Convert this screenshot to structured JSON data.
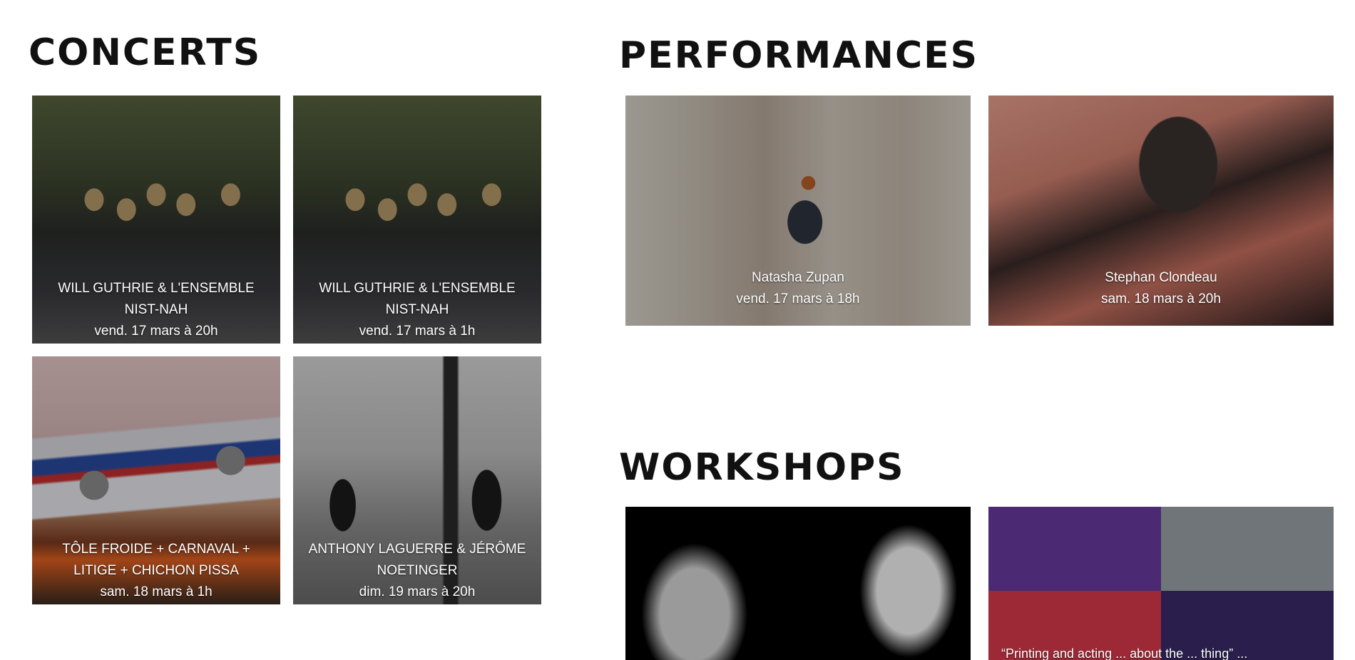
{
  "sections": {
    "concerts": {
      "title": "CONCERTS",
      "cards": [
        {
          "title": "WILL GUTHRIE & l'ENSEMBLE NIST-NAH",
          "date": "vend. 17 mars à 20h"
        },
        {
          "title": "WILL GUTHRIE & l'ENSEMBLE NIST-NAH",
          "date": "vend. 17 mars à 1h"
        },
        {
          "title": "TÔLE FROIDE + CARNAVAL + LITIGE + CHICHON PISSA",
          "date": "sam. 18 mars à 1h"
        },
        {
          "title": "ANTHONY LAGUERRE & JÉRÔME NOETINGER",
          "date": "dim. 19 mars à 20h"
        }
      ]
    },
    "performances": {
      "title": "PERFORMANCES",
      "cards": [
        {
          "title": "Natasha Zupan",
          "date": "vend. 17 mars à 18h"
        },
        {
          "title": "Stephan Clondeau",
          "date": "sam. 18 mars à 20h"
        }
      ]
    },
    "workshops": {
      "title": "WORKSHOPS",
      "cards": [
        {
          "title": "",
          "date": ""
        },
        {
          "title": "“Printing and acting ... about the ... thing” ...",
          "date": ""
        }
      ]
    }
  }
}
